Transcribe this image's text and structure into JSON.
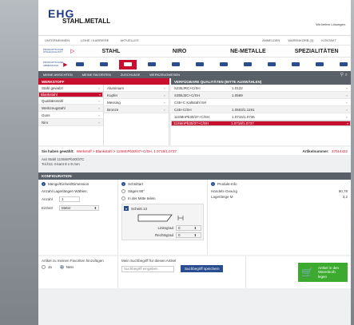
{
  "header": {
    "logo_top": "EHG",
    "logo_bottom": "STAHL.METALL",
    "tagline": "Wir liefern Lösungen."
  },
  "nav": {
    "left": [
      "Unternehmen",
      "Leihe / Karriere",
      "Aktuelles"
    ],
    "right": [
      "Anmelden",
      "Warenkorb (3)",
      "Kontakt"
    ]
  },
  "categories": {
    "tag": "PRODUKTSUCHE\nSTAHLQUALITÄT",
    "items": [
      "STAHL",
      "NIRO",
      "NE-METALLE",
      "SPEZIALITÄTEN"
    ]
  },
  "shapes": {
    "tag": "PRODUKTSUCHE\nABMESSUNG",
    "count": 12,
    "active_index": 2
  },
  "subtabs": {
    "items": [
      "Meine Ansichten",
      "Meine Favoriten",
      "Zuschläge",
      "Werkzeugwesen"
    ]
  },
  "werkstoff": {
    "header": "Werkstoff",
    "col1": [
      {
        "label": "Stahl gewalzt",
        "selected": false
      },
      {
        "label": "Blankstahl",
        "selected": true
      },
      {
        "label": "Qualitätsstahl",
        "selected": false
      },
      {
        "label": "Werkzeugstahl",
        "selected": false
      },
      {
        "label": "Guss",
        "selected": false
      },
      {
        "label": "Niro",
        "selected": false
      }
    ],
    "col2": [
      {
        "label": "Aluminium"
      },
      {
        "label": "Kupfer"
      },
      {
        "label": "Messing"
      },
      {
        "label": "Bronze"
      }
    ]
  },
  "qualitaeten": {
    "header": "Verfügbare Qualitäten (bitte auswählen)",
    "rows": [
      {
        "name": "S235JRC+C/SH",
        "code": "1.0122",
        "selected": false
      },
      {
        "name": "S355J2C+C/SH",
        "code": "1.0569",
        "selected": false
      },
      {
        "name": "C45+C Kaltstahl SH",
        "code": "",
        "selected": false
      },
      {
        "name": "C45+C/SH",
        "code": "1.0503/1.1191",
        "selected": false
      },
      {
        "name": "11SMnPb30/37+C/SH",
        "code": "1.0715/1.0736",
        "selected": false
      },
      {
        "name": "11SMnPb30/37+C/SH",
        "code": "1.0718/1.0737",
        "selected": true
      }
    ]
  },
  "selection": {
    "label": "Sie haben gewählt:",
    "value": "Werkstoff > Blankstahl > 11SMnPb30/37+C/SH, 1.0718/1.0737",
    "article_label": "Artikelnummer:",
    "article_number": "37014422"
  },
  "info": {
    "line1": "Aut Stahl 11SMnPb30/37C",
    "line2": "Tol.h11 4-kant 8 x 8 mm"
  },
  "config": {
    "header": "Konfiguration",
    "col_a": {
      "title": "Menge/Einheit/Dimension",
      "subtitle": "Anzahl Lagerlängen Wählen:",
      "anzahl_label": "Anzahl",
      "anzahl_value": "1",
      "einheit_label": "Einheit",
      "einheit_value": "Meter"
    },
    "col_b": {
      "title": "Schnittart",
      "option1": "Sägen 90°",
      "option2": "In der Mitte teilen",
      "schnitt_label": "Schnitt 13",
      "linksgrad_label": "Linksgrad",
      "linksgrad_value": "0",
      "rechtsgrad_label": "Rechtsgrad",
      "rechtsgrad_value": "0"
    },
    "col_c": {
      "title": "Produkt-Info",
      "rows": [
        {
          "k": "Handels-Gew.kg",
          "v": "90,78"
        },
        {
          "k": "Lagerlänge M",
          "v": "3,2"
        }
      ]
    }
  },
  "bottom": {
    "fav_text": "Artikel zu meinen Favoriten hinzufügen",
    "fav_no": "Ja",
    "fav_yes": "Nein",
    "search_title": "Mein Suchbegriff für diesen Artikel",
    "search_placeholder": "Suchbegriff eingeben",
    "save_label": "Suchbegriff speichern",
    "cart_label": "Artikel in den Warenkorb legen"
  },
  "colors": {
    "brand_red": "#c8102e",
    "brand_blue": "#2a4d8f",
    "cart_green": "#3caa2e"
  }
}
